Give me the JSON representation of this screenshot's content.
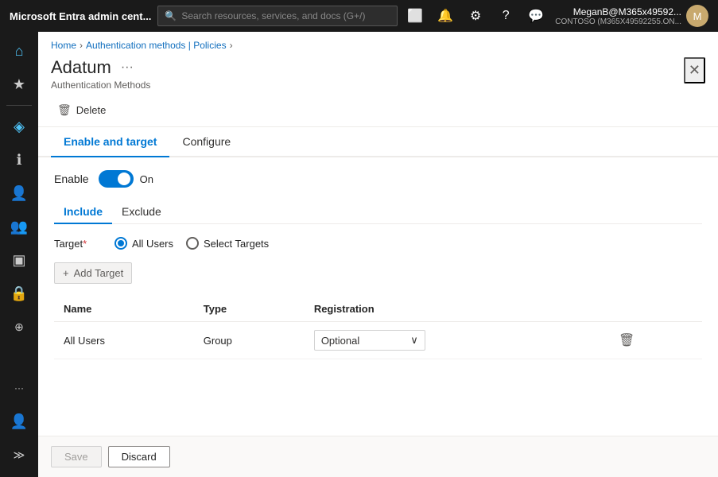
{
  "topbar": {
    "title": "Microsoft Entra admin cent...",
    "search_placeholder": "Search resources, services, and docs (G+/)",
    "user_name": "MeganB@M365x49592...",
    "user_tenant": "CONTOSO (M365X49592255.ON...",
    "user_initials": "M"
  },
  "sidebar": {
    "items": [
      {
        "name": "home",
        "icon": "⌂"
      },
      {
        "name": "favorites",
        "icon": "★"
      },
      {
        "name": "divider",
        "icon": ""
      },
      {
        "name": "identity",
        "icon": "◈"
      },
      {
        "name": "info",
        "icon": "ℹ"
      },
      {
        "name": "users",
        "icon": "👤"
      },
      {
        "name": "groups",
        "icon": "👥"
      },
      {
        "name": "apps",
        "icon": "▣"
      },
      {
        "name": "security",
        "icon": "🔒"
      },
      {
        "name": "compliance",
        "icon": "⊕"
      },
      {
        "name": "more",
        "icon": "···"
      },
      {
        "name": "account",
        "icon": "👤"
      }
    ]
  },
  "breadcrumb": {
    "home": "Home",
    "separator1": "›",
    "link1": "Authentication methods | Policies",
    "separator2": "›"
  },
  "panel": {
    "title": "Adatum",
    "subtitle": "Authentication Methods",
    "ellipsis": "···",
    "close": "✕"
  },
  "toolbar": {
    "delete_label": "Delete",
    "delete_icon": "🗑"
  },
  "tabs": {
    "items": [
      {
        "label": "Enable and target",
        "active": true
      },
      {
        "label": "Configure",
        "active": false
      }
    ]
  },
  "enable_section": {
    "label": "Enable",
    "toggle_state": "On"
  },
  "sub_tabs": {
    "items": [
      {
        "label": "Include",
        "active": true
      },
      {
        "label": "Exclude",
        "active": false
      }
    ]
  },
  "target": {
    "label": "Target",
    "required_marker": "*",
    "options": [
      {
        "label": "All Users",
        "selected": true
      },
      {
        "label": "Select Targets",
        "selected": false
      }
    ]
  },
  "add_target": {
    "label": "Add Target",
    "icon": "+"
  },
  "table": {
    "columns": [
      {
        "label": "Name"
      },
      {
        "label": "Type"
      },
      {
        "label": "Registration"
      }
    ],
    "rows": [
      {
        "name": "All Users",
        "type": "Group",
        "registration": "Optional"
      }
    ]
  },
  "footer": {
    "save_label": "Save",
    "discard_label": "Discard"
  }
}
